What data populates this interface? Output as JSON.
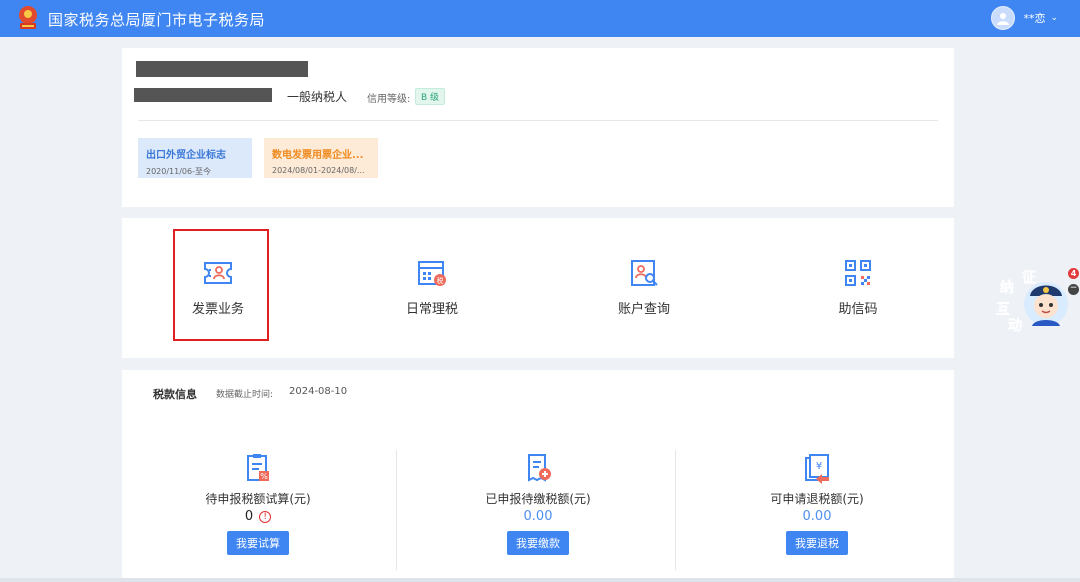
{
  "header": {
    "title": "国家税务总局厦门市电子税务局",
    "user_name": "**恋",
    "chevron": "⌄",
    "emblem_icon": "tax-emblem-icon",
    "avatar_icon": "user-avatar-icon"
  },
  "company": {
    "taxpayer_type": "一般纳税人",
    "credit_label": "信用等级:",
    "credit_value": "B 级",
    "tags": [
      {
        "title": "出口外贸企业标志",
        "date": "2020/11/06-至今"
      },
      {
        "title": "数电发票用票企业...",
        "date": "2024/08/01-2024/08/..."
      }
    ]
  },
  "functions": [
    {
      "label": "发票业务",
      "icon": "invoice-ticket-icon"
    },
    {
      "label": "日常理税",
      "icon": "daily-tax-icon"
    },
    {
      "label": "账户查询",
      "icon": "account-search-icon"
    },
    {
      "label": "助信码",
      "icon": "qr-code-icon"
    }
  ],
  "tax_info": {
    "title": "税款信息",
    "time_label": "数据截止时间:",
    "time_value": "2024-08-10",
    "columns": [
      {
        "label": "待申报税额试算(元)",
        "amount": "0",
        "button": "我要试算",
        "icon": "clipboard-calc-icon",
        "info_icon": "info-icon",
        "info_glyph": "!"
      },
      {
        "label": "已申报待缴税额(元)",
        "amount": "0.00",
        "button": "我要缴款",
        "icon": "tax-payment-icon"
      },
      {
        "label": "可申请退税额(元)",
        "amount": "0.00",
        "button": "我要退税",
        "icon": "tax-refund-icon"
      }
    ]
  },
  "assistant": {
    "chars": [
      "征",
      "纳",
      "互",
      "动"
    ],
    "badge": "4",
    "collapse": "−",
    "icon": "assistant-mascot-icon"
  },
  "colors": {
    "brand_blue": "#3f86f3",
    "highlight_red": "#e02020",
    "amount_blue": "#4d8ff0"
  }
}
